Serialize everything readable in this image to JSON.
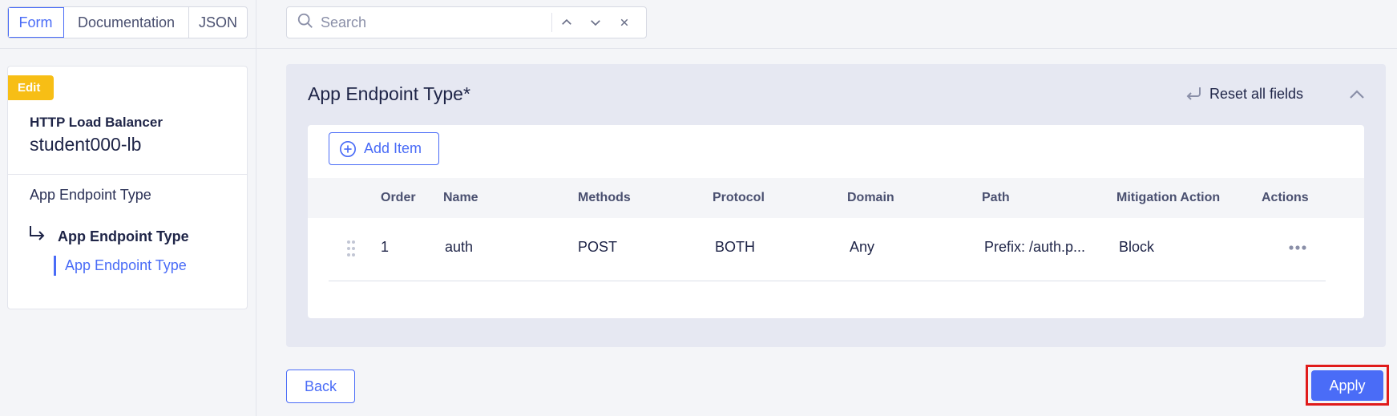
{
  "view_tabs": [
    {
      "label": "Form",
      "active": true
    },
    {
      "label": "Documentation",
      "active": false
    },
    {
      "label": "JSON",
      "active": false
    }
  ],
  "search": {
    "placeholder": "Search",
    "value": ""
  },
  "sidebar": {
    "badge": "Edit",
    "object_kind": "HTTP Load Balancer",
    "object_name": "student000-lb",
    "section": "App Endpoint Type",
    "current": "App Endpoint Type",
    "sub_item": "App Endpoint Type"
  },
  "panel": {
    "title": "App Endpoint Type*",
    "reset_label": "Reset all fields",
    "add_item_label": "Add Item",
    "columns": [
      "Order",
      "Name",
      "Methods",
      "Protocol",
      "Domain",
      "Path",
      "Mitigation Action",
      "Actions"
    ],
    "rows": [
      {
        "order": "1",
        "name": "auth",
        "methods": "POST",
        "protocol": "BOTH",
        "domain": "Any",
        "path": "Prefix: /auth.p...",
        "mitigation": "Block"
      }
    ]
  },
  "footer": {
    "back_label": "Back",
    "apply_label": "Apply"
  },
  "colors": {
    "accent": "#4a6cf7",
    "badge": "#f7be15",
    "highlight": "#e01b1b"
  }
}
